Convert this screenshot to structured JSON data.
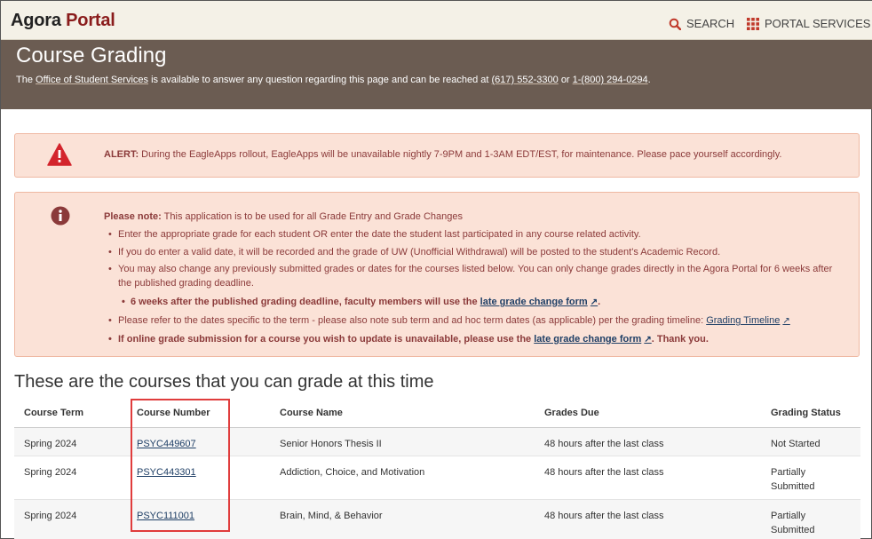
{
  "brand": {
    "part1": "Agora",
    "part2": "Portal"
  },
  "topnav": {
    "search": "SEARCH",
    "portal": "PORTAL SERVICES"
  },
  "hero": {
    "title": "Course Grading",
    "info_prefix": "The",
    "office_link": "Office of Student Services",
    "info_mid": "is available to answer any question regarding this page and can be reached at",
    "phone1": "(617) 552-3300",
    "info_or": "or",
    "phone2": "1-(800) 294-0294",
    "info_end": "."
  },
  "alert": {
    "label": "ALERT:",
    "text": "During the EagleApps rollout, EagleApps will be unavailable nightly 7-9PM and 1-3AM EDT/EST, for maintenance. Please pace yourself accordingly."
  },
  "note": {
    "label": "Please note:",
    "intro": "This application is to be used for all Grade Entry and Grade Changes",
    "b1": "Enter the appropriate grade for each student OR enter the date the student last participated in any course related activity.",
    "b2": "If you do enter a valid date, it will be recorded and the grade of UW (Unofficial Withdrawal) will be posted to the student's Academic Record.",
    "b3": "You may also change any previously submitted grades or dates for the courses listed below. You can only change grades directly in the Agora Portal for 6 weeks after the published grading deadline.",
    "sub_text": "6 weeks after the published grading deadline, faculty members will use the",
    "sub_link": "late grade change form",
    "sub_end": ".",
    "b4_text": "Please refer to the dates specific to the term - please also note sub term and ad hoc term dates (as applicable) per the grading timeline:",
    "b4_link": "Grading Timeline",
    "b5_text": "If online grade submission for a course you wish to update is unavailable, please use the",
    "b5_link": "late grade change form",
    "b5_end": ". Thank you."
  },
  "section_title": "These are the courses that you can grade at this time",
  "table": {
    "headers": [
      "Course Term",
      "Course Number",
      "Course Name",
      "Grades Due",
      "Grading Status"
    ],
    "rows": [
      {
        "term": "Spring 2024",
        "number": "PSYC449607",
        "name": "Senior Honors Thesis II",
        "due": "48 hours after the last class",
        "status": "Not Started"
      },
      {
        "term": "Spring 2024",
        "number": "PSYC443301",
        "name": "Addiction, Choice, and Motivation",
        "due": "48 hours after the last class",
        "status": "Partially Submitted"
      },
      {
        "term": "Spring 2024",
        "number": "PSYC111001",
        "name": "Brain, Mind, & Behavior",
        "due": "48 hours after the last class",
        "status": "Partially Submitted"
      }
    ]
  },
  "colors": {
    "accent": "#8a1c1c",
    "hero_bg": "#6b5c52",
    "alert_bg": "#fbe2d7",
    "link": "#1f3f66",
    "highlight": "#e03c3c"
  },
  "icons": {
    "search": "search-icon",
    "grid": "grid-icon",
    "warning": "warning-icon",
    "info": "info-icon",
    "external": "external-link-icon"
  }
}
